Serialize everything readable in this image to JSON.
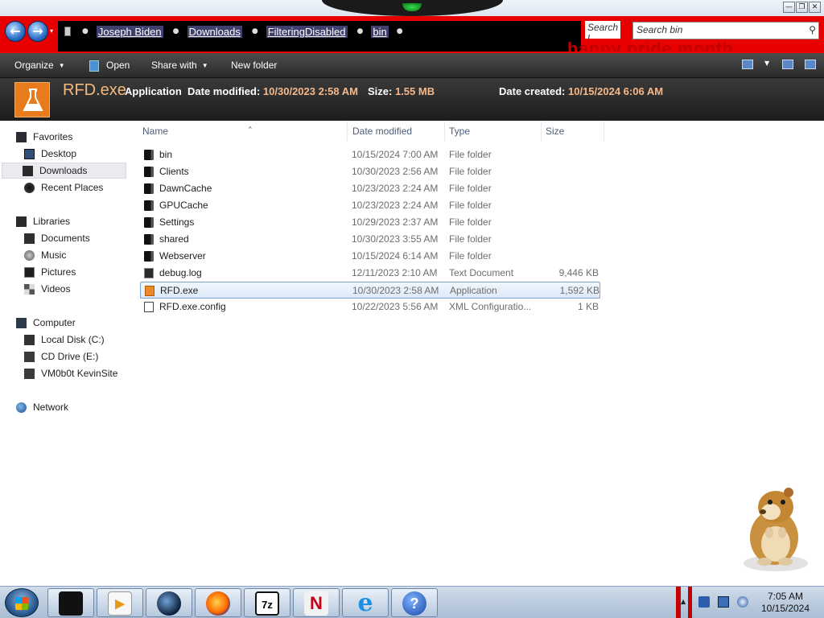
{
  "window": {
    "controls": {
      "minimize": "—",
      "maximize": "❐",
      "close": "✕"
    }
  },
  "address": {
    "back_glyph": "←",
    "forward_glyph": "→",
    "dropdown_glyph": "▾",
    "crumb_separator": "●",
    "breadcrumbs": [
      "Joseph Biden",
      "Downloads",
      "FilteringDisabled",
      "bin"
    ],
    "search_small": "Search l",
    "search_placeholder": "Search bin",
    "search_icon_glyph": "⚲",
    "banner_text": "happy pride month"
  },
  "toolbar": {
    "organize_label": "Organize",
    "open_label": "Open",
    "share_label": "Share with",
    "new_folder_label": "New folder",
    "dropdown_glyph": "▼"
  },
  "details": {
    "file_name": "RFD.exe",
    "type_label": "Application",
    "modified_key": "Date modified:",
    "modified_value": "10/30/2023 2:58 AM",
    "size_key": "Size:",
    "size_value": "1.55 MB",
    "created_key": "Date created:",
    "created_value": "10/15/2024 6:06 AM"
  },
  "nav": {
    "favorites": "Favorites",
    "desktop": "Desktop",
    "downloads": "Downloads",
    "recent": "Recent Places",
    "libraries": "Libraries",
    "documents": "Documents",
    "music": "Music",
    "pictures": "Pictures",
    "videos": "Videos",
    "computer": "Computer",
    "local_disk": "Local Disk (C:)",
    "cd_drive": "CD Drive (E:)",
    "vm": "VM0b0t KevinSite",
    "network": "Network"
  },
  "columns": {
    "name": "Name",
    "date": "Date modified",
    "type": "Type",
    "size": "Size",
    "sort_glyph": "^"
  },
  "files": [
    {
      "name": "bin",
      "date": "10/15/2024 7:00 AM",
      "type": "File folder",
      "size": "",
      "icon": "folder-icon"
    },
    {
      "name": "Clients",
      "date": "10/30/2023 2:56 AM",
      "type": "File folder",
      "size": "",
      "icon": "folder-icon"
    },
    {
      "name": "DawnCache",
      "date": "10/23/2023 2:24 AM",
      "type": "File folder",
      "size": "",
      "icon": "folder-icon"
    },
    {
      "name": "GPUCache",
      "date": "10/23/2023 2:24 AM",
      "type": "File folder",
      "size": "",
      "icon": "folder-icon"
    },
    {
      "name": "Settings",
      "date": "10/29/2023 2:37 AM",
      "type": "File folder",
      "size": "",
      "icon": "folder-icon"
    },
    {
      "name": "shared",
      "date": "10/30/2023 3:55 AM",
      "type": "File folder",
      "size": "",
      "icon": "folder-icon"
    },
    {
      "name": "Webserver",
      "date": "10/15/2024 6:14 AM",
      "type": "File folder",
      "size": "",
      "icon": "folder-icon"
    },
    {
      "name": "debug.log",
      "date": "12/11/2023 2:10 AM",
      "type": "Text Document",
      "size": "9,446 KB",
      "icon": "text-document-icon"
    },
    {
      "name": "RFD.exe",
      "date": "10/30/2023 2:58 AM",
      "type": "Application",
      "size": "1,592 KB",
      "icon": "application-icon",
      "selected": true
    },
    {
      "name": "RFD.exe.config",
      "date": "10/22/2023 5:56 AM",
      "type": "XML Configuratio...",
      "size": "1 KB",
      "icon": "config-file-icon"
    }
  ],
  "taskbar": {
    "apps": [
      {
        "name": "explorer",
        "glyph": ""
      },
      {
        "name": "media-player",
        "glyph": "▶"
      },
      {
        "name": "globe",
        "glyph": ""
      },
      {
        "name": "firefox",
        "glyph": ""
      },
      {
        "name": "7zip",
        "glyph": "7z"
      },
      {
        "name": "n-app",
        "glyph": "N"
      },
      {
        "name": "internet-explorer",
        "glyph": "e"
      },
      {
        "name": "help",
        "glyph": "?"
      }
    ],
    "tray_up_glyph": "▲",
    "time": "7:05 AM",
    "date": "10/15/2024"
  },
  "colors": {
    "address_bar": "#e80000",
    "command_bar": "#2a2a2a",
    "details_value": "#f5b88a",
    "selection_border": "#7da2ce"
  }
}
